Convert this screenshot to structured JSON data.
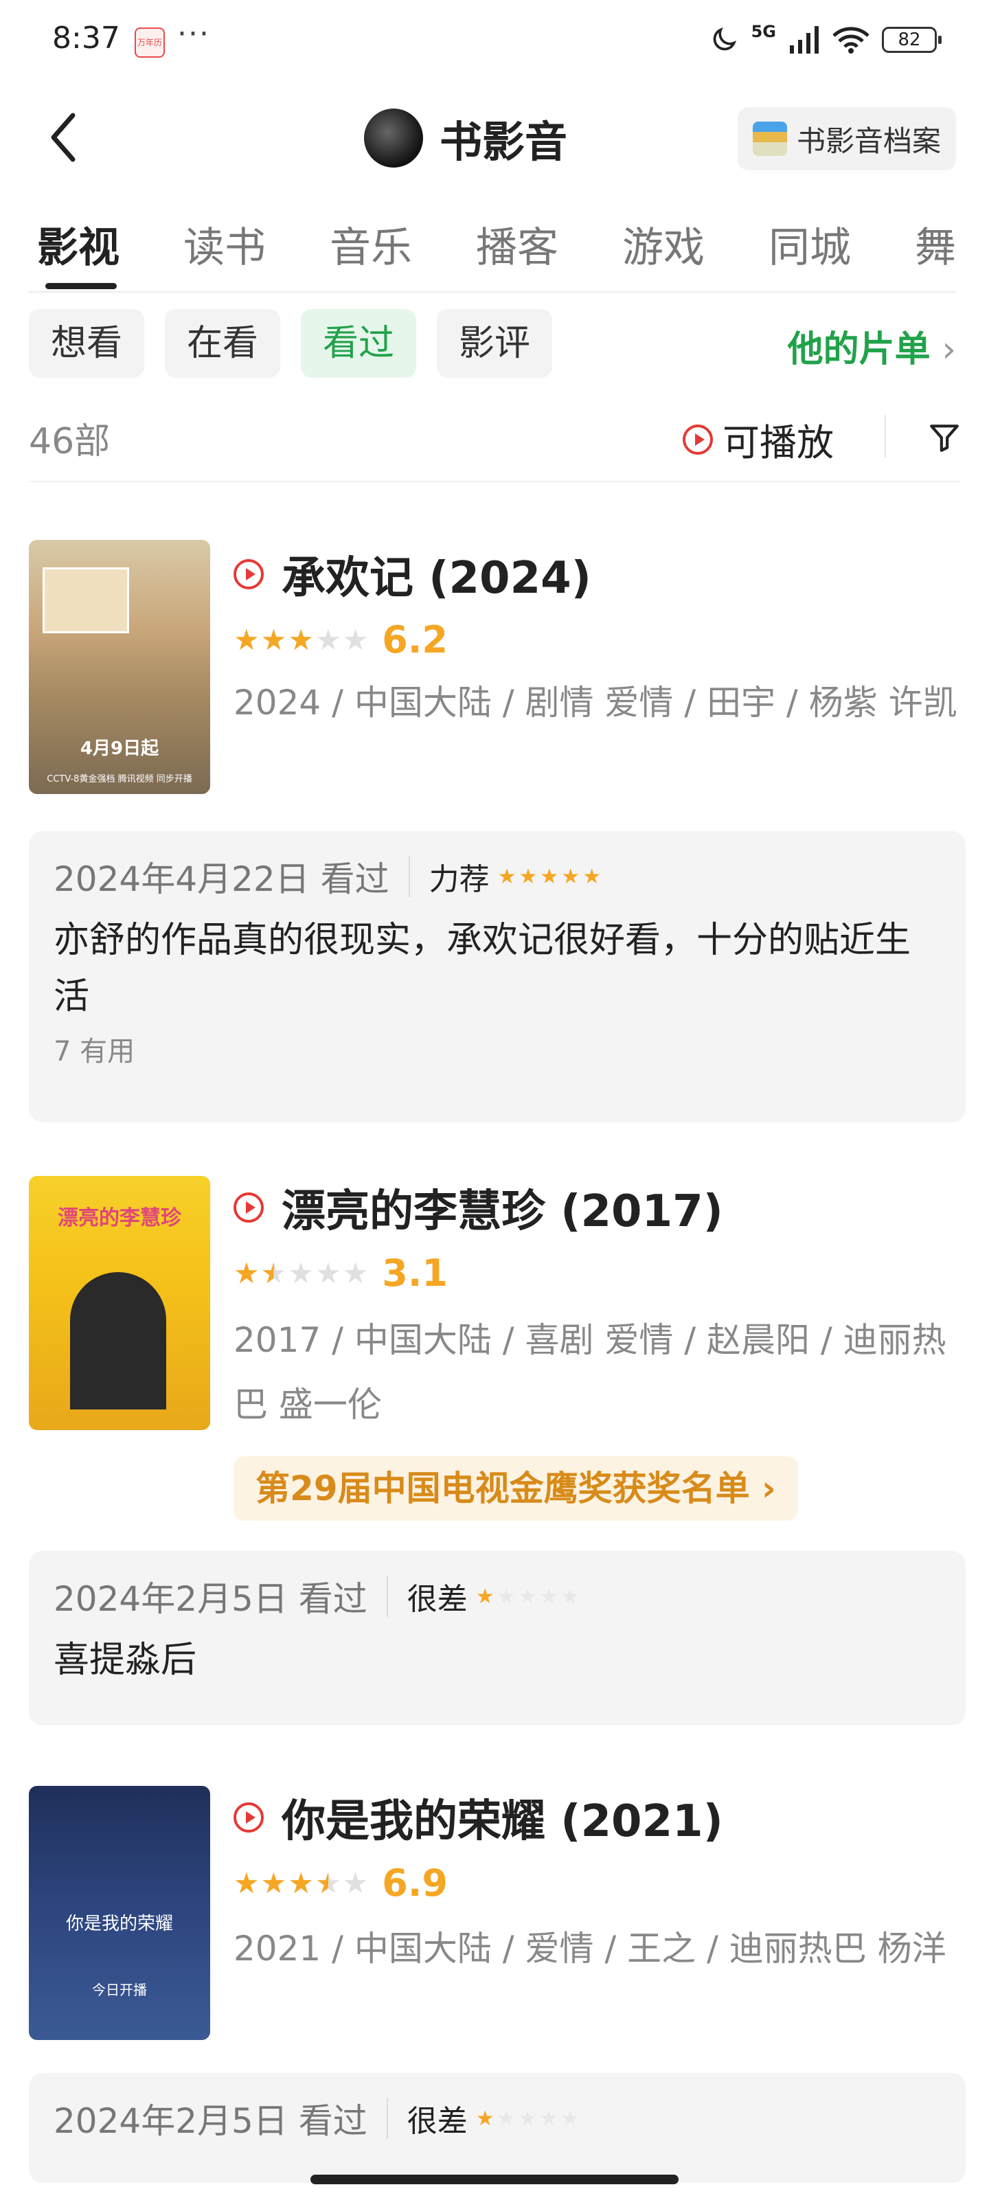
{
  "status_bar": {
    "time": "8:37",
    "dots": "···",
    "app_icon_text": "万年历",
    "network": "5G",
    "battery": "82"
  },
  "header": {
    "title": "书影音",
    "archive_label": "书影音档案"
  },
  "tabs": [
    {
      "label": "影视",
      "active": true
    },
    {
      "label": "读书"
    },
    {
      "label": "音乐"
    },
    {
      "label": "播客"
    },
    {
      "label": "游戏"
    },
    {
      "label": "同城"
    },
    {
      "label": "舞"
    }
  ],
  "filters": [
    {
      "label": "想看"
    },
    {
      "label": "在看"
    },
    {
      "label": "看过",
      "active": true
    },
    {
      "label": "影评"
    }
  ],
  "list_link": "他的片单",
  "count": "46部",
  "playable_label": "可播放",
  "movies": [
    {
      "title": "承欢记 (2024)",
      "rating": 3.0,
      "score": "6.2",
      "meta": "2024 / 中国大陆 / 剧情 爱情 / 田宇 / 杨紫 许凯",
      "poster_caption": "4月9日起",
      "poster_sub": "CCTV-8黄金强档 腾讯视频 同步开播",
      "review": {
        "date": "2024年4月22日 看过",
        "grade": "力荐",
        "user_stars": 5,
        "text": "亦舒的作品真的很现实，承欢记很好看，十分的贴近生活",
        "useful": "7 有用"
      }
    },
    {
      "title": "漂亮的李慧珍 (2017)",
      "rating": 1.5,
      "score": "3.1",
      "meta": "2017 / 中国大陆 / 喜剧 爱情 / 赵晨阳 / 迪丽热巴 盛一伦",
      "poster_caption": "漂亮的李慧珍",
      "award": "第29届中国电视金鹰奖获奖名单",
      "review": {
        "date": "2024年2月5日 看过",
        "grade": "很差",
        "user_stars": 1,
        "text": "喜提淼后"
      }
    },
    {
      "title": "你是我的荣耀 (2021)",
      "rating": 3.5,
      "score": "6.9",
      "meta": "2021 / 中国大陆 / 爱情 / 王之 / 迪丽热巴 杨洋",
      "poster_caption": "你是我的荣耀",
      "poster_sub": "今日开播",
      "review": {
        "date": "2024年2月5日 看过",
        "grade": "很差",
        "user_stars": 1
      }
    }
  ]
}
